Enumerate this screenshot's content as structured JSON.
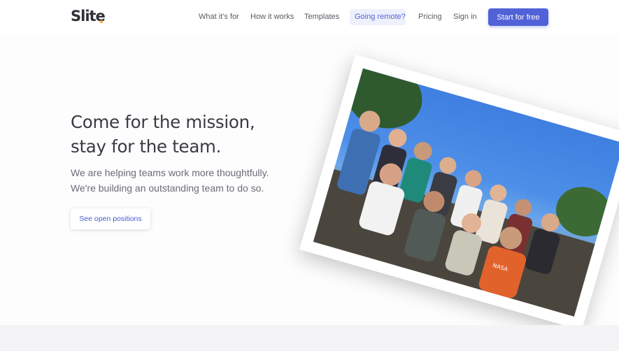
{
  "nav": {
    "logo": "Slite",
    "links": [
      "What it's for",
      "How it works",
      "Templates",
      "Going remote?",
      "Pricing",
      "Sign in"
    ],
    "cta": "Start for free"
  },
  "hero": {
    "title_line1": "Come for the mission,",
    "title_line2": "stay for the team.",
    "subtitle_line1": "We are helping teams work more thoughtfully.",
    "subtitle_line2": "We're building an outstanding team to do so.",
    "button": "See open positions"
  },
  "photo": {
    "description_icon": "team-photo",
    "shirt_text": "NASA"
  },
  "colors": {
    "accent": "#5161d7",
    "logo_dot": "#f5a623"
  }
}
